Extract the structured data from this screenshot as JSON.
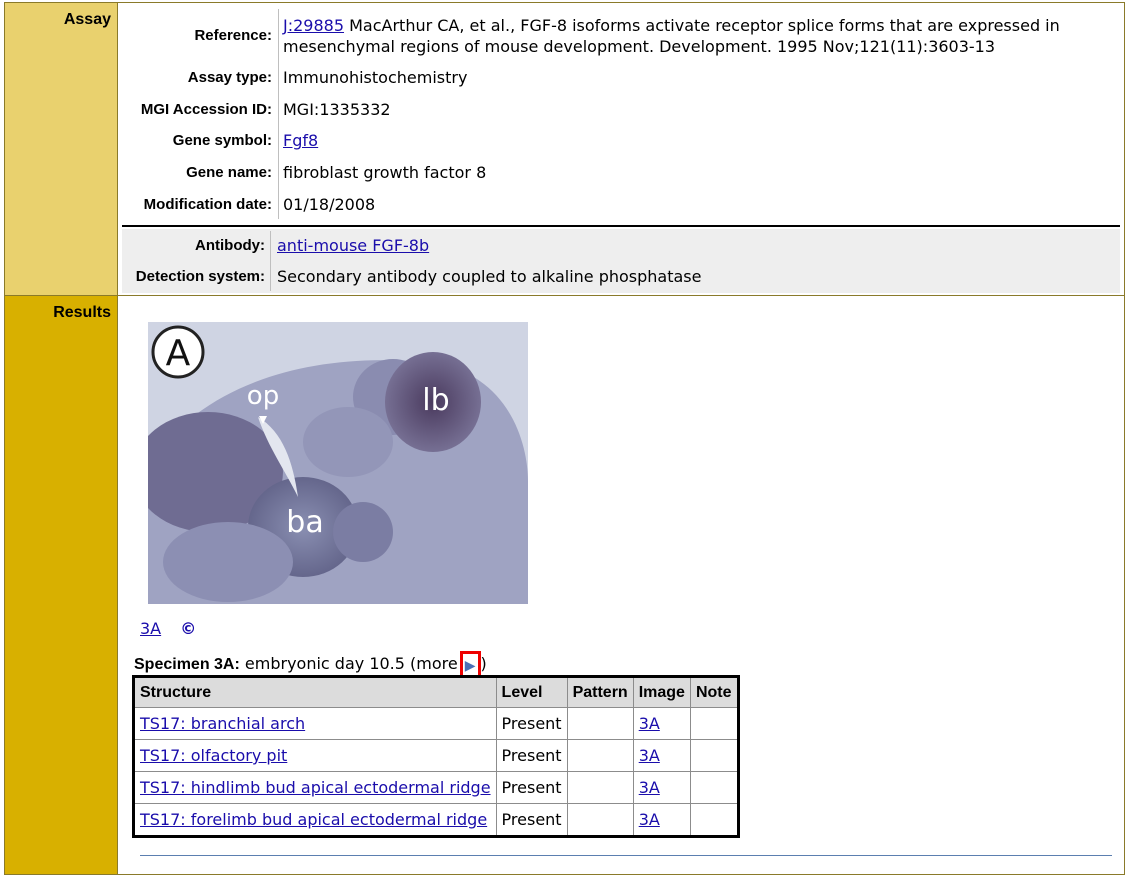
{
  "assay": {
    "section_label": "Assay",
    "reference_label": "Reference:",
    "reference_id": "J:29885",
    "reference_text": "MacArthur CA, et al., FGF-8 isoforms activate receptor splice forms that are expressed in mesenchymal regions of mouse development. Development. 1995 Nov;121(11):3603-13",
    "assay_type_label": "Assay type:",
    "assay_type": "Immunohistochemistry",
    "accession_label": "MGI Accession ID:",
    "accession": "MGI:1335332",
    "gene_symbol_label": "Gene symbol:",
    "gene_symbol": "Fgf8",
    "gene_name_label": "Gene name:",
    "gene_name": "fibroblast growth factor 8",
    "mod_date_label": "Modification date:",
    "mod_date": "01/18/2008",
    "antibody_label": "Antibody:",
    "antibody": "anti-mouse FGF-8b",
    "detection_label": "Detection system:",
    "detection": "Secondary antibody coupled to alkaline phosphatase"
  },
  "results": {
    "section_label": "Results",
    "image": {
      "panel_letter": "A",
      "labels": [
        "op",
        "lb",
        "ba"
      ]
    },
    "figure_link": "3A",
    "copyright_symbol": "©",
    "specimen_label": "Specimen 3A:",
    "specimen_text": "embryonic day 10.5 (more",
    "specimen_close": ")",
    "more_icon": "play-arrow-icon",
    "table": {
      "headers": [
        "Structure",
        "Level",
        "Pattern",
        "Image",
        "Note"
      ],
      "rows": [
        {
          "structure": "TS17: branchial arch",
          "level": "Present",
          "pattern": "",
          "image": "3A",
          "note": ""
        },
        {
          "structure": "TS17: olfactory pit",
          "level": "Present",
          "pattern": "",
          "image": "3A",
          "note": ""
        },
        {
          "structure": "TS17: hindlimb bud apical ectodermal ridge",
          "level": "Present",
          "pattern": "",
          "image": "3A",
          "note": ""
        },
        {
          "structure": "TS17: forelimb bud apical ectodermal ridge",
          "level": "Present",
          "pattern": "",
          "image": "3A",
          "note": ""
        }
      ]
    }
  },
  "colors": {
    "assay_sidebar": "#e9d16e",
    "results_sidebar": "#d8b000",
    "link": "#1a0dab",
    "highlight_box": "#ee0000"
  }
}
